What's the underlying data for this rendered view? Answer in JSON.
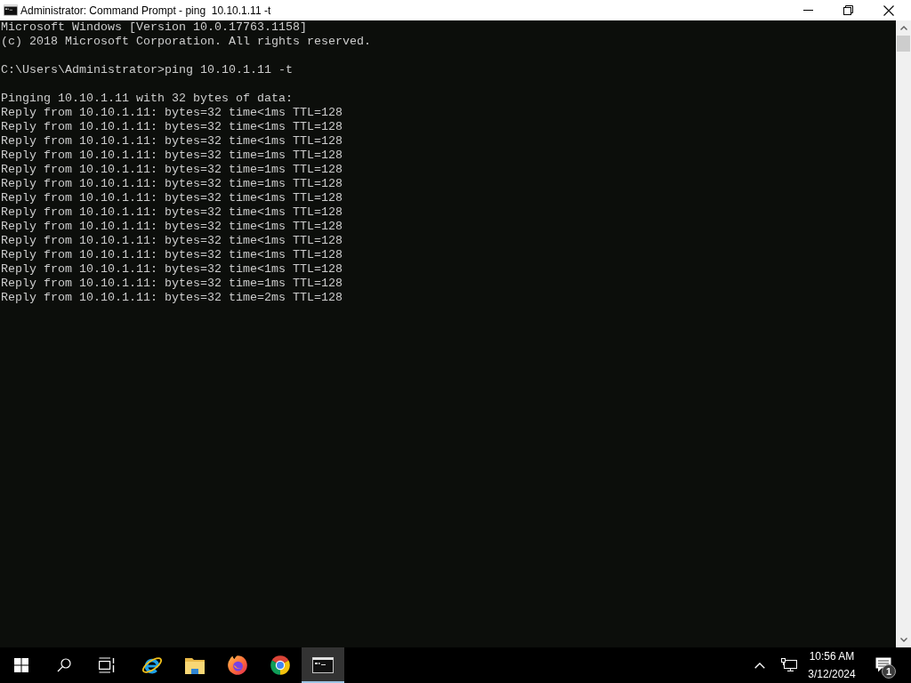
{
  "window": {
    "title": "Administrator: Command Prompt - ping  10.10.1.11 -t"
  },
  "console": {
    "blocks": [
      {
        "lines": [
          "Microsoft Windows [Version 10.0.17763.1158]",
          "(c) 2018 Microsoft Corporation. All rights reserved."
        ]
      },
      {
        "lines": [
          "C:\\Users\\Administrator>ping 10.10.1.11 -t"
        ]
      },
      {
        "lines": [
          "Pinging 10.10.1.11 with 32 bytes of data:",
          "Reply from 10.10.1.11: bytes=32 time<1ms TTL=128",
          "Reply from 10.10.1.11: bytes=32 time<1ms TTL=128",
          "Reply from 10.10.1.11: bytes=32 time<1ms TTL=128",
          "Reply from 10.10.1.11: bytes=32 time=1ms TTL=128",
          "Reply from 10.10.1.11: bytes=32 time=1ms TTL=128",
          "Reply from 10.10.1.11: bytes=32 time=1ms TTL=128",
          "Reply from 10.10.1.11: bytes=32 time<1ms TTL=128",
          "Reply from 10.10.1.11: bytes=32 time<1ms TTL=128",
          "Reply from 10.10.1.11: bytes=32 time<1ms TTL=128",
          "Reply from 10.10.1.11: bytes=32 time<1ms TTL=128",
          "Reply from 10.10.1.11: bytes=32 time<1ms TTL=128",
          "Reply from 10.10.1.11: bytes=32 time<1ms TTL=128",
          "Reply from 10.10.1.11: bytes=32 time=1ms TTL=128",
          "Reply from 10.10.1.11: bytes=32 time=2ms TTL=128"
        ]
      }
    ]
  },
  "taskbar": {
    "apps": [
      {
        "kind": "ie",
        "selected": false
      },
      {
        "kind": "explorer",
        "selected": false
      },
      {
        "kind": "firefox",
        "selected": false
      },
      {
        "kind": "chrome",
        "selected": false
      },
      {
        "kind": "console",
        "selected": true
      }
    ]
  },
  "tray": {
    "time": "10:56 AM",
    "date": "3/12/2024",
    "notifications": "1"
  }
}
